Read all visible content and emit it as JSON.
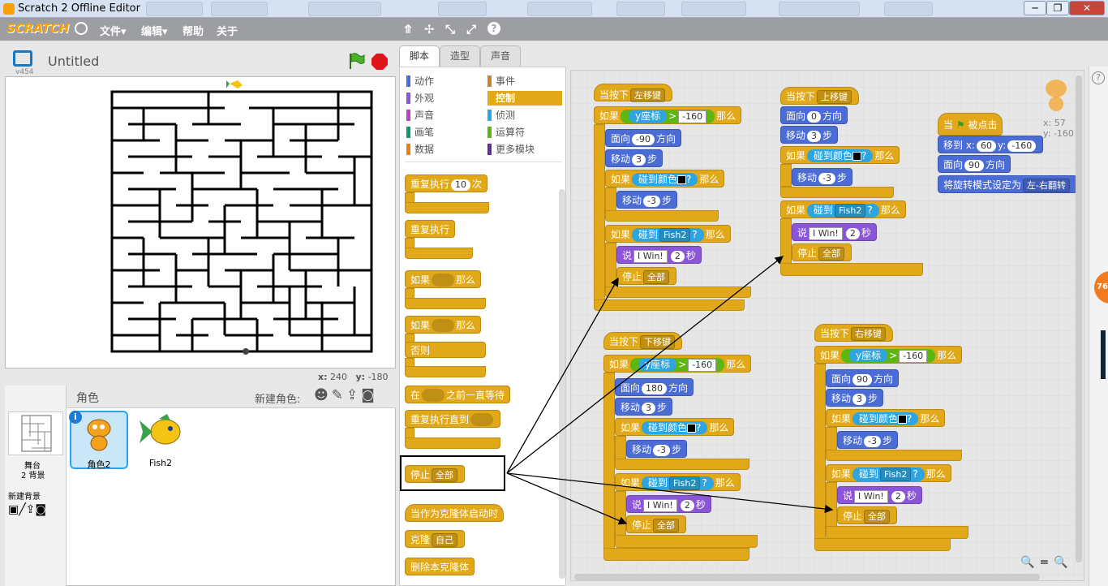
{
  "window": {
    "title": "Scratch 2 Offline Editor",
    "controls": [
      "─",
      "❐",
      "✕"
    ]
  },
  "menu": {
    "logo": "SCRATCH",
    "items": [
      "文件▾",
      "编辑▾",
      "帮助",
      "关于"
    ],
    "tools": [
      "⤊",
      "✢",
      "⤡",
      "⤢",
      "?"
    ]
  },
  "stage": {
    "version": "v454",
    "title": "Untitled",
    "coords": {
      "xlabel": "x:",
      "x": "240",
      "ylabel": "y:",
      "y": "-180"
    }
  },
  "sprites": {
    "header": "角色",
    "new_sprite": "新建角色:",
    "stage_label": "舞台",
    "backdrops": "2 背景",
    "new_backdrop": "新建背景",
    "items": [
      "角色2",
      "Fish2"
    ]
  },
  "tabs": [
    "脚本",
    "造型",
    "声音"
  ],
  "categories": [
    {
      "label": "动作",
      "color": "#4a6cd4"
    },
    {
      "label": "事件",
      "color": "#c88330"
    },
    {
      "label": "外观",
      "color": "#8a55d7"
    },
    {
      "label": "控制",
      "color": "#e1a91a"
    },
    {
      "label": "声音",
      "color": "#bb42c3"
    },
    {
      "label": "侦测",
      "color": "#2ca5e2"
    },
    {
      "label": "画笔",
      "color": "#0e9a6c"
    },
    {
      "label": "运算符",
      "color": "#5cb712"
    },
    {
      "label": "数据",
      "color": "#ee7d16"
    },
    {
      "label": "更多模块",
      "color": "#632d99"
    }
  ],
  "palette_blocks": {
    "repeat": "重复执行",
    "repeat_n": "10",
    "repeat_times": "次",
    "forever": "重复执行",
    "if": "如果",
    "then": "那么",
    "else": "否则",
    "wait_until_pre": "在",
    "wait_until_post": "之前一直等待",
    "repeat_until": "重复执行直到",
    "stop": "停止",
    "stop_opt": "全部",
    "clone_start": "当作为克隆体启动时",
    "clone": "克隆",
    "clone_opt": "自己",
    "delete_clone": "删除本克隆体"
  },
  "scripts": {
    "left": {
      "hat": "当按下",
      "key": "左移键",
      "if": "如果",
      "ycoord": "y座标",
      "gt": ">",
      "val": "-160",
      "then": "那么",
      "face": "面向",
      "dir": "-90",
      "dirlabel": "方向",
      "move": "移动",
      "steps": "3",
      "stepslabel": "步",
      "touchcolor": "碰到颜色",
      "q": "?",
      "back": "-3",
      "touch": "碰到",
      "fish": "Fish2",
      "say": "说",
      "win": "I Win!",
      "secs": "2",
      "secslabel": "秒",
      "stop": "停止",
      "all": "全部"
    },
    "up": {
      "key": "上移键",
      "dir": "0"
    },
    "down": {
      "key": "下移键",
      "dir": "180"
    },
    "right": {
      "key": "右移键",
      "dir": "90"
    },
    "flag": {
      "when": "当",
      "clicked": "被点击",
      "goto": "移到 x:",
      "x": "60",
      "ylab": "y:",
      "y": "-160",
      "face": "面向",
      "dir": "90",
      "dirlabel": "方向",
      "rot": "将旋转模式设定为",
      "rotopt": "左-右翻转"
    },
    "sprite_info": {
      "x": "x: 57",
      "y": "y: -160"
    }
  },
  "badge": "76",
  "zoom": [
    "🔍",
    "=",
    "🔍"
  ]
}
